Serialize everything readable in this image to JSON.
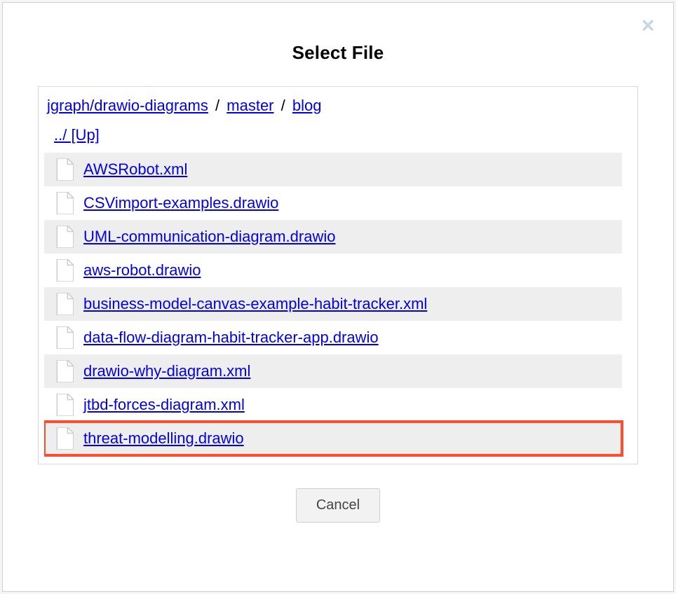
{
  "dialog": {
    "title": "Select File",
    "close_label": "×"
  },
  "breadcrumb": {
    "parts": [
      "jgraph/drawio-diagrams",
      "master",
      "blog"
    ],
    "separator": "/"
  },
  "nav": {
    "up_label": "../ [Up]"
  },
  "files": [
    {
      "name": "AWSRobot.xml",
      "highlighted": false
    },
    {
      "name": "CSVimport-examples.drawio",
      "highlighted": false
    },
    {
      "name": "UML-communication-diagram.drawio",
      "highlighted": false
    },
    {
      "name": "aws-robot.drawio",
      "highlighted": false
    },
    {
      "name": "business-model-canvas-example-habit-tracker.xml",
      "highlighted": false
    },
    {
      "name": "data-flow-diagram-habit-tracker-app.drawio",
      "highlighted": false
    },
    {
      "name": "drawio-why-diagram.xml",
      "highlighted": false
    },
    {
      "name": "jtbd-forces-diagram.xml",
      "highlighted": false
    },
    {
      "name": "threat-modelling.drawio",
      "highlighted": true
    }
  ],
  "buttons": {
    "cancel_label": "Cancel"
  }
}
